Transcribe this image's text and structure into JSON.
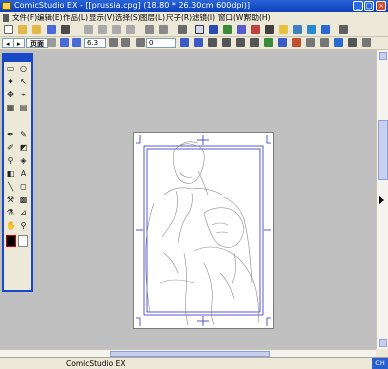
{
  "window": {
    "title": "ComicStudio EX - [[prussia.cpg] (18.80 * 26.30cm 600dpi)]",
    "min_label": "_",
    "max_label": "□",
    "close_label": "×"
  },
  "menu": {
    "items": [
      "文件(F)",
      "编辑(E)",
      "作品(L)",
      "显示(V)",
      "选择(S)",
      "图层(L)",
      "尺子(R)",
      "滤镜(I)",
      "窗口(W)",
      "帮助(H)"
    ]
  },
  "tabs": {
    "page": "页面",
    "zoom": "6.3",
    "angle": "0"
  },
  "status": {
    "app": "ComicStudio EX",
    "ime": "CH"
  },
  "colors": {
    "accent": "#1648c8",
    "workspace": "#c0c0c0",
    "guide": "#3030c0",
    "sketch": "#9a9a9a"
  },
  "icons": {
    "palette": [
      "select-rect-icon",
      "lasso-icon",
      "magic-wand-icon",
      "move-icon",
      "zoom-layer-icon",
      "line-select-icon",
      "object-icon",
      "pen-icon",
      "pencil-icon",
      "marker-icon",
      "brush-icon",
      "eraser-icon",
      "fill-icon",
      "gradient-icon",
      "text-icon",
      "pattern-icon",
      "ruler-icon",
      "shape-icon",
      "correction-icon",
      "hand-icon",
      "zoom-icon"
    ]
  }
}
